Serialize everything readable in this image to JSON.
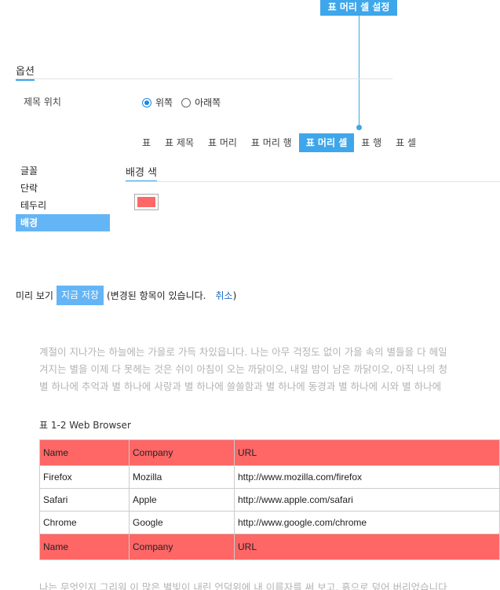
{
  "callout": {
    "label": "표 머리 셀 설정"
  },
  "options": {
    "title": "옵션",
    "caption_position": {
      "label": "제목 위치",
      "choices": [
        {
          "label": "위쪽",
          "checked": true
        },
        {
          "label": "아래쪽",
          "checked": false
        }
      ]
    }
  },
  "tabs": [
    {
      "label": "표",
      "active": false
    },
    {
      "label": "표 제목",
      "active": false
    },
    {
      "label": "표 머리",
      "active": false
    },
    {
      "label": "표 머리 행",
      "active": false
    },
    {
      "label": "표 머리 셀",
      "active": true
    },
    {
      "label": "표 행",
      "active": false
    },
    {
      "label": "표 셀",
      "active": false
    }
  ],
  "side_menu": [
    {
      "label": "글꼴",
      "active": false
    },
    {
      "label": "단락",
      "active": false
    },
    {
      "label": "테두리",
      "active": false
    },
    {
      "label": "배경",
      "active": true
    }
  ],
  "panel": {
    "title": "배경 색",
    "color": "#ff6666"
  },
  "preview_bar": {
    "label": "미리 보기",
    "save_label": "지금 저장",
    "status_text": "(변경된 항목이 있습니다.",
    "cancel_label": "취소",
    "close_paren": ")"
  },
  "preview": {
    "paragraph_lines": [
      "계절이 지나가는 하늘에는 가을로 가득 차있읍니다. 나는 아무 걱정도 없이 가을 속의 별들을 다 헤일",
      "겨지는 별을 이제 다 못헤는 것은 쉬이 아침이 오는 까닭이오, 내일 밤이 남은 까닭이오, 아직 나의 청",
      "별 하나에 추억과 별 하나에 사랑과 별 하나에 쓸쓸함과 별 하나에 동경과 별 하나에 시와 별 하나에"
    ],
    "paragraph_2": "나는 무엇인지 그리워 이 많은 별빛이 내린 언덕위에 내 이름자를 써 보고, 흙으로 덮어 버리었습니다",
    "table_caption": "표 1-2  Web Browser",
    "table": {
      "header": [
        "Name",
        "Company",
        "URL"
      ],
      "rows": [
        [
          "Firefox",
          "Mozilla",
          "http://www.mozilla.com/firefox"
        ],
        [
          "Safari",
          "Apple",
          "http://www.apple.com/safari"
        ],
        [
          "Chrome",
          "Google",
          "http://www.google.com/chrome"
        ]
      ],
      "footer": [
        "Name",
        "Company",
        "URL"
      ],
      "header_color": "#ff6666"
    }
  }
}
